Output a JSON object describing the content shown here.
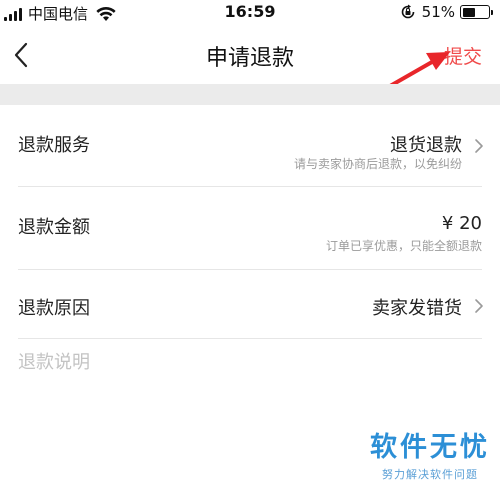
{
  "status_bar": {
    "carrier": "中国电信",
    "time": "16:59",
    "battery_percent": "51%",
    "battery_level": 0.51,
    "icons": [
      "signal-icon",
      "wifi-icon",
      "rotation-lock-icon",
      "battery-icon"
    ]
  },
  "nav": {
    "title": "申请退款",
    "submit_label": "提交",
    "back_icon": "chevron-left-icon"
  },
  "form": {
    "service": {
      "label": "退款服务",
      "value": "退货退款",
      "hint": "请与卖家协商后退款，以免纠纷"
    },
    "amount": {
      "label": "退款金额",
      "value": "¥ 20",
      "hint": "订单已享优惠，只能全额退款"
    },
    "reason": {
      "label": "退款原因",
      "value": "卖家发错货"
    },
    "description": {
      "placeholder": "退款说明"
    }
  },
  "watermark": {
    "title": "软件无忧",
    "subtitle": "努力解决软件问题"
  },
  "colors": {
    "accent": "#f04a4a",
    "arrow": "#e8262a",
    "band": "#ebebeb",
    "hint": "#9b9b9b",
    "placeholder": "#c3c3c3",
    "watermark": "#2c8fd6"
  }
}
